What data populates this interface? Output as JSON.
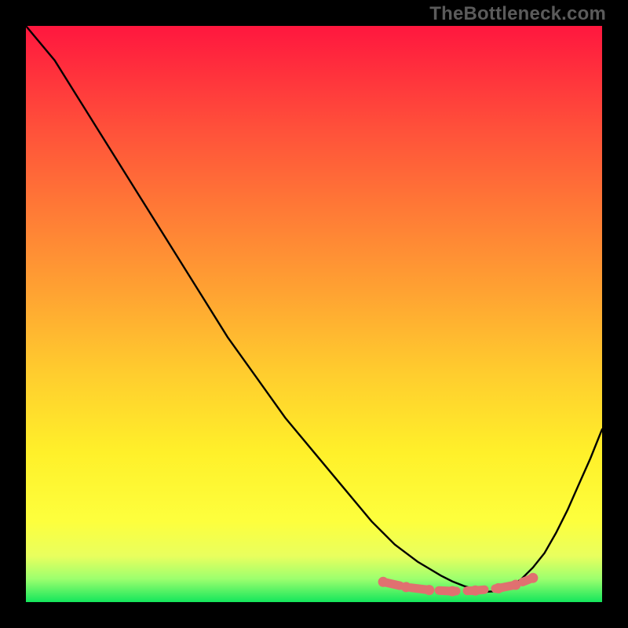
{
  "watermark": "TheBottleneck.com",
  "colors": {
    "background": "#000000",
    "curve": "#000000",
    "marker": "#e07070",
    "gradient_top": "#ff173e",
    "gradient_bottom": "#14e65c"
  },
  "chart_data": {
    "type": "line",
    "title": "",
    "xlabel": "",
    "ylabel": "",
    "xlim": [
      0,
      100
    ],
    "ylim": [
      0,
      100
    ],
    "x": [
      0,
      5,
      10,
      15,
      20,
      25,
      30,
      35,
      40,
      45,
      50,
      55,
      60,
      62,
      64,
      66,
      68,
      70,
      72,
      74,
      76,
      78,
      80,
      82,
      84,
      86,
      88,
      90,
      92,
      94,
      96,
      98,
      100
    ],
    "y": [
      100,
      94,
      86,
      78,
      70,
      62,
      54,
      46,
      39,
      32,
      26,
      20,
      14,
      12,
      10,
      8.5,
      7,
      5.8,
      4.6,
      3.6,
      2.8,
      2.2,
      1.8,
      1.9,
      2.6,
      4,
      6,
      8.5,
      12,
      16,
      20.5,
      25,
      30
    ],
    "series": [
      {
        "name": "bottleneck-curve",
        "x": [
          0,
          5,
          10,
          15,
          20,
          25,
          30,
          35,
          40,
          45,
          50,
          55,
          60,
          62,
          64,
          66,
          68,
          70,
          72,
          74,
          76,
          78,
          80,
          82,
          84,
          86,
          88,
          90,
          92,
          94,
          96,
          98,
          100
        ],
        "y": [
          100,
          94,
          86,
          78,
          70,
          62,
          54,
          46,
          39,
          32,
          26,
          20,
          14,
          12,
          10,
          8.5,
          7,
          5.8,
          4.6,
          3.6,
          2.8,
          2.2,
          1.8,
          1.9,
          2.6,
          4,
          6,
          8.5,
          12,
          16,
          20.5,
          25,
          30
        ]
      }
    ],
    "markers": {
      "name": "highlight-band",
      "points": [
        {
          "x": 62,
          "y": 3.5
        },
        {
          "x": 66,
          "y": 2.6
        },
        {
          "x": 70,
          "y": 2.1
        },
        {
          "x": 74,
          "y": 1.9
        },
        {
          "x": 78,
          "y": 2.0
        },
        {
          "x": 82,
          "y": 2.4
        },
        {
          "x": 85,
          "y": 3.0
        },
        {
          "x": 88,
          "y": 4.2
        }
      ]
    }
  }
}
